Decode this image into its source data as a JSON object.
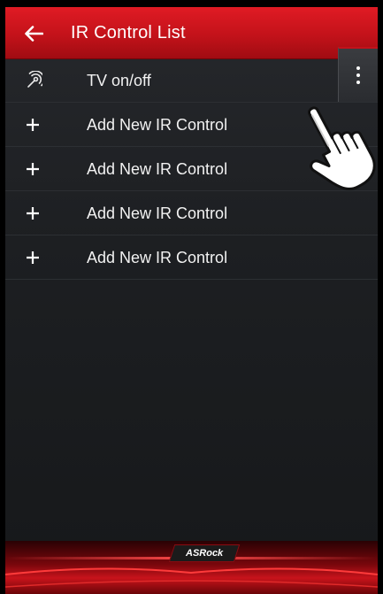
{
  "appbar": {
    "title": "IR Control List",
    "back_icon": "arrow-left-icon",
    "accent": "#d0151d"
  },
  "list": {
    "items": [
      {
        "label": "TV on/off",
        "icon": "remote-signal-icon"
      },
      {
        "label": "Add New IR Control",
        "icon": "plus-icon"
      },
      {
        "label": "Add New IR Control",
        "icon": "plus-icon"
      },
      {
        "label": "Add New IR Control",
        "icon": "plus-icon"
      },
      {
        "label": "Add New IR Control",
        "icon": "plus-icon"
      }
    ]
  },
  "overflow_menu": {
    "icon": "more-vertical-icon"
  },
  "pointer": {
    "icon": "hand-pointer-icon"
  },
  "footer": {
    "brand": "ASRock"
  }
}
